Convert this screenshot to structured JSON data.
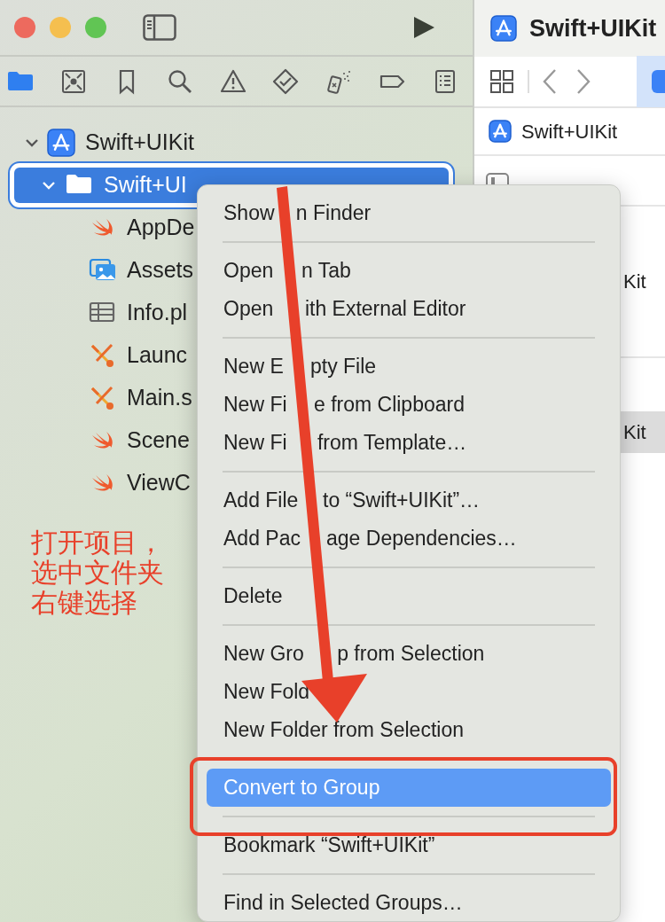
{
  "titlebar": {
    "traffic_lights": [
      {
        "color": "#ed6a5e"
      },
      {
        "color": "#f5bf4f"
      },
      {
        "color": "#61c554"
      }
    ]
  },
  "navigator_tabs": [
    {
      "kind": "folder",
      "selected": true
    },
    {
      "kind": "source",
      "selected": false
    },
    {
      "kind": "bookmark",
      "selected": false
    },
    {
      "kind": "search",
      "selected": false
    },
    {
      "kind": "issue",
      "selected": false
    },
    {
      "kind": "test",
      "selected": false
    },
    {
      "kind": "debug",
      "selected": false
    },
    {
      "kind": "breakpoint",
      "selected": false
    },
    {
      "kind": "report",
      "selected": false
    }
  ],
  "tree": [
    {
      "label": "Swift+UIKit",
      "kind": "project",
      "expanded": true,
      "selected": false,
      "children": [
        {
          "label": "Swift+UI",
          "kind": "folder",
          "expanded": true,
          "selected": true,
          "children": [
            {
              "label": "AppDe",
              "kind": "swift",
              "selected": false
            },
            {
              "label": "Assets",
              "kind": "assets",
              "selected": false
            },
            {
              "label": "Info.pl",
              "kind": "plist",
              "selected": false
            },
            {
              "label": "Launc",
              "kind": "storyboard",
              "selected": false
            },
            {
              "label": "Main.s",
              "kind": "storyboard",
              "selected": false
            },
            {
              "label": "Scene",
              "kind": "swift",
              "selected": false
            },
            {
              "label": "ViewC",
              "kind": "swift",
              "selected": false
            }
          ]
        }
      ]
    }
  ],
  "annotation": {
    "lines": [
      "打开项目，",
      "选中文件夹",
      "右键选择"
    ]
  },
  "editor": {
    "title": "Swift+UIKit",
    "tab_selected": true,
    "file": "Swift+UIKit",
    "rows": [
      {
        "text": "Kit",
        "selected": false
      },
      {
        "text": "Kit",
        "selected": true
      }
    ]
  },
  "context_menu": {
    "items": [
      {
        "kind": "item",
        "parts": [
          "Show",
          "n Finder"
        ],
        "selected": false
      },
      {
        "kind": "separator"
      },
      {
        "kind": "item",
        "parts": [
          "Open",
          "n Tab"
        ],
        "selected": false
      },
      {
        "kind": "item",
        "parts": [
          "Open",
          "ith External Editor"
        ],
        "selected": false
      },
      {
        "kind": "separator"
      },
      {
        "kind": "item",
        "parts": [
          "New E",
          "pty File"
        ],
        "selected": false
      },
      {
        "kind": "item",
        "parts": [
          "New Fi",
          "e from Clipboard"
        ],
        "selected": false
      },
      {
        "kind": "item",
        "parts": [
          "New Fi",
          "from Template…"
        ],
        "selected": false
      },
      {
        "kind": "separator"
      },
      {
        "kind": "item",
        "parts": [
          "Add File",
          "to “Swift+UIKit”…"
        ],
        "selected": false
      },
      {
        "kind": "item",
        "parts": [
          "Add Pac",
          "age Dependencies…"
        ],
        "selected": false
      },
      {
        "kind": "separator"
      },
      {
        "kind": "item",
        "parts": [
          "Delete"
        ],
        "selected": false
      },
      {
        "kind": "separator"
      },
      {
        "kind": "item",
        "parts": [
          "New Gro",
          "p from Selection"
        ],
        "selected": false
      },
      {
        "kind": "item",
        "parts": [
          "New Fold"
        ],
        "selected": false
      },
      {
        "kind": "item",
        "parts": [
          "New Folder from Selection"
        ],
        "selected": false
      },
      {
        "kind": "separator"
      },
      {
        "kind": "item",
        "parts": [
          "Convert to Group"
        ],
        "selected": true
      },
      {
        "kind": "separator"
      },
      {
        "kind": "item",
        "parts": [
          "Bookmark “Swift+UIKit”"
        ],
        "selected": false
      },
      {
        "kind": "separator"
      },
      {
        "kind": "item",
        "parts": [
          "Find in Selected Groups…"
        ],
        "selected": false
      }
    ]
  }
}
